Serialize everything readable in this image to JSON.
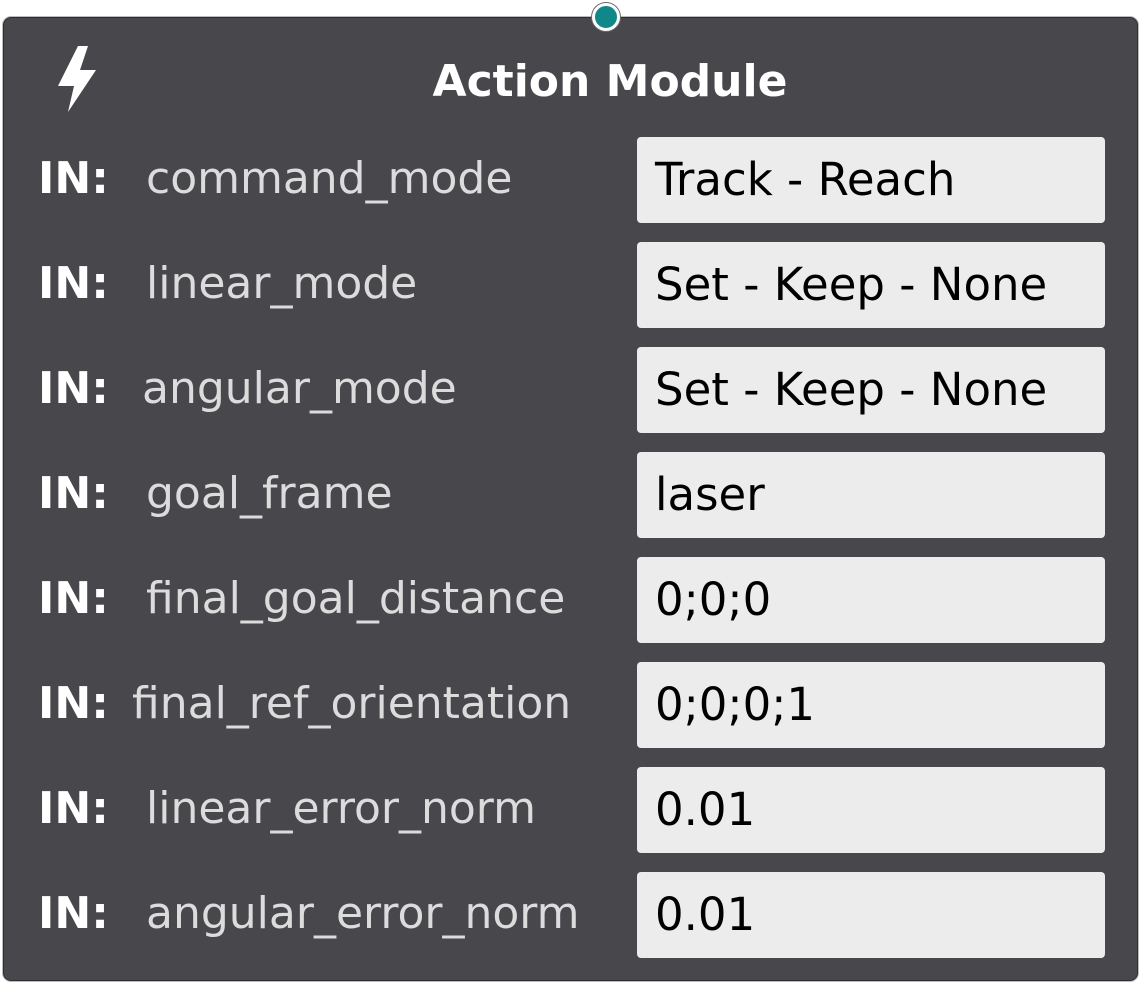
{
  "node": {
    "title": "Action Module",
    "icon": "lightning-bolt-icon",
    "colors": {
      "background": "#48474c",
      "connector": "#10888a",
      "field": "#ececec"
    },
    "inputs": [
      {
        "prefix": "IN:",
        "name": "command_mode",
        "value": "Track - Reach"
      },
      {
        "prefix": "IN:",
        "name": "linear_mode",
        "value": "Set - Keep - None"
      },
      {
        "prefix": "IN:",
        "name": "angular_mode",
        "value": "Set - Keep - None"
      },
      {
        "prefix": "IN:",
        "name": "goal_frame",
        "value": "laser"
      },
      {
        "prefix": "IN:",
        "name": "final_goal_distance",
        "value": "0;0;0"
      },
      {
        "prefix": "IN:",
        "name": "final_ref_orientation",
        "value": "0;0;0;1"
      },
      {
        "prefix": "IN:",
        "name": "linear_error_norm",
        "value": "0.01"
      },
      {
        "prefix": "IN:",
        "name": "angular_error_norm",
        "value": "0.01"
      }
    ]
  }
}
